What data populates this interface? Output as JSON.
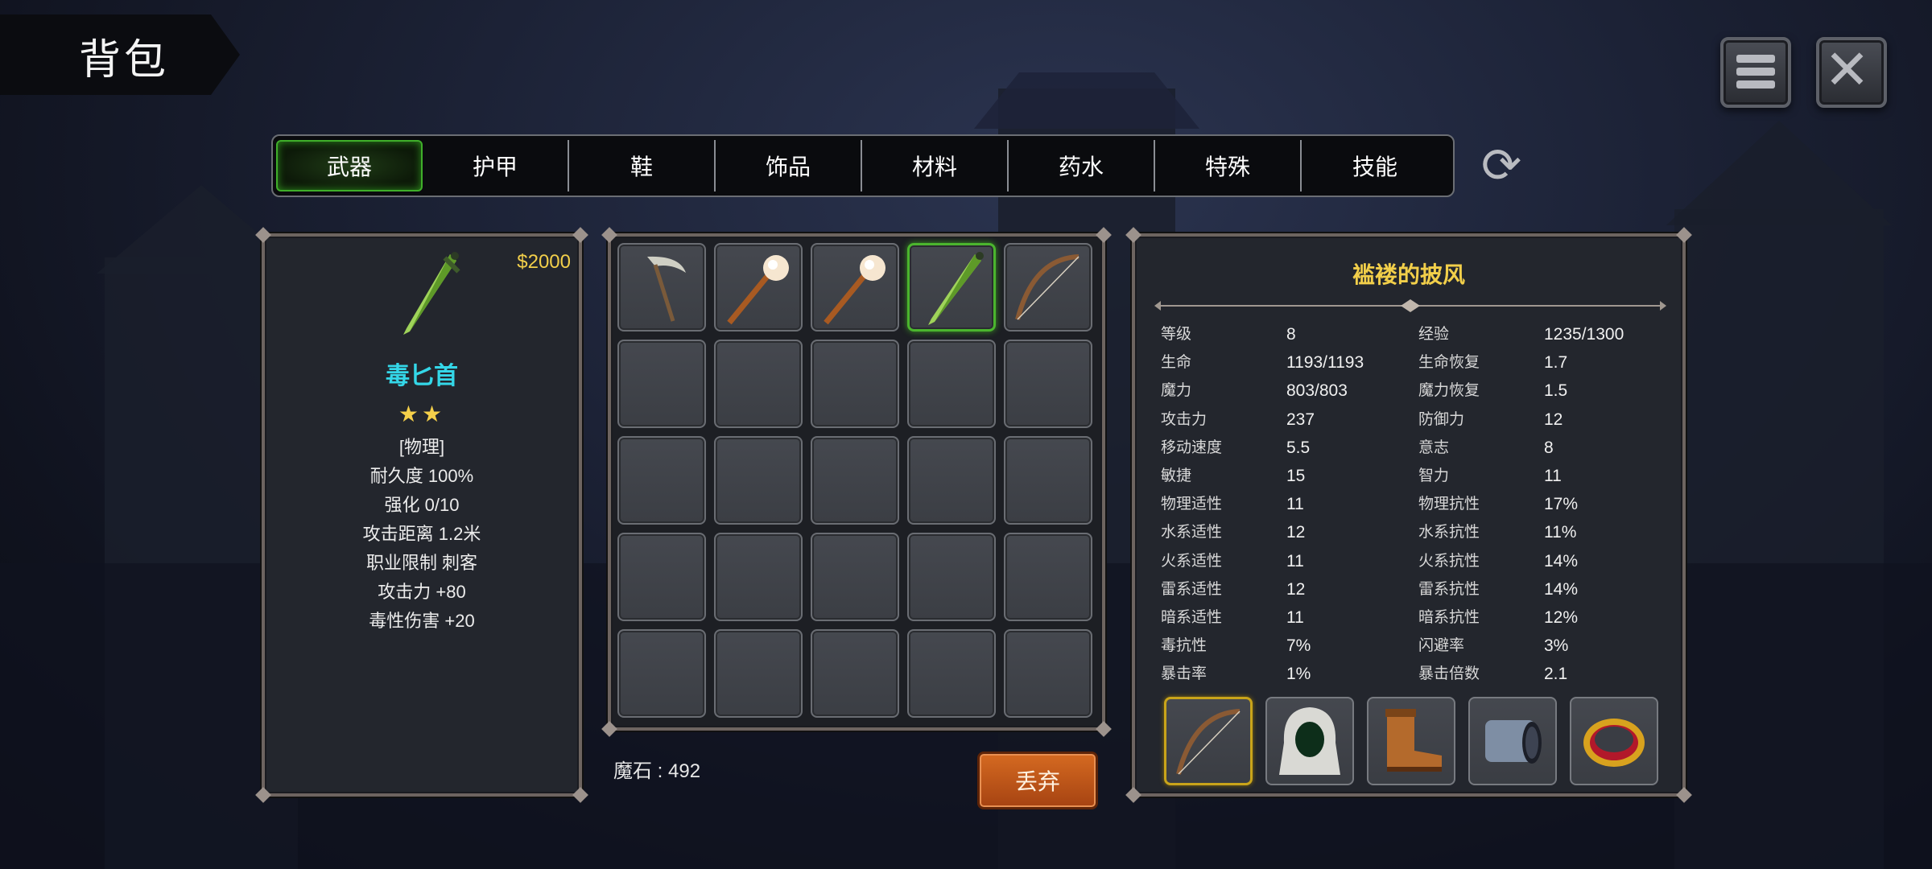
{
  "header": {
    "title": "背包"
  },
  "tabs": [
    {
      "label": "武器",
      "active": true
    },
    {
      "label": "护甲"
    },
    {
      "label": "鞋"
    },
    {
      "label": "饰品"
    },
    {
      "label": "材料"
    },
    {
      "label": "药水"
    },
    {
      "label": "特殊"
    },
    {
      "label": "技能"
    }
  ],
  "selected_item": {
    "price": "$2000",
    "icon": "poison-dagger-icon",
    "name": "毒匕首",
    "stars": "★★",
    "lines": [
      "[物理]",
      "耐久度 100%",
      "强化 0/10",
      "攻击距离  1.2米",
      "职业限制  刺客",
      "攻击力  +80",
      "毒性伤害  +20"
    ]
  },
  "inventory": {
    "slots": [
      {
        "icon": "scythe-icon"
      },
      {
        "icon": "orb-staff-icon"
      },
      {
        "icon": "orb-staff-icon"
      },
      {
        "icon": "poison-dagger-icon",
        "selected": true
      },
      {
        "icon": "bow-icon"
      }
    ],
    "total_slots": 25,
    "magic_stone_label": "魔石 : 492",
    "discard_label": "丢弃"
  },
  "stats": {
    "title": "褴褛的披风",
    "rows": [
      [
        "等级",
        "8",
        "经验",
        "1235/1300"
      ],
      [
        "生命",
        "1193/1193",
        "生命恢复",
        "1.7"
      ],
      [
        "魔力",
        "803/803",
        "魔力恢复",
        "1.5"
      ],
      [
        "攻击力",
        "237",
        "防御力",
        "12"
      ],
      [
        "移动速度",
        "5.5",
        "意志",
        "8"
      ],
      [
        "敏捷",
        "15",
        "智力",
        "11"
      ],
      [
        "物理适性",
        "11",
        "物理抗性",
        "17%"
      ],
      [
        "水系适性",
        "12",
        "水系抗性",
        "11%"
      ],
      [
        "火系适性",
        "11",
        "火系抗性",
        "14%"
      ],
      [
        "雷系适性",
        "12",
        "雷系抗性",
        "14%"
      ],
      [
        "暗系适性",
        "11",
        "暗系抗性",
        "12%"
      ],
      [
        "毒抗性",
        "7%",
        "闪避率",
        "3%"
      ],
      [
        "暴击率",
        "1%",
        "暴击倍数",
        "2.1"
      ]
    ],
    "equipped": [
      {
        "icon": "bow-icon",
        "highlight": true
      },
      {
        "icon": "hood-cloak-icon"
      },
      {
        "icon": "boots-icon"
      },
      {
        "icon": "bracer-icon"
      },
      {
        "icon": "gold-ring-icon"
      }
    ]
  },
  "colors": {
    "accent_green": "#3fae2a",
    "price_gold": "#f2cf4a",
    "item_name_cyan": "#34d7e8",
    "discard_orange": "#c2561a"
  }
}
